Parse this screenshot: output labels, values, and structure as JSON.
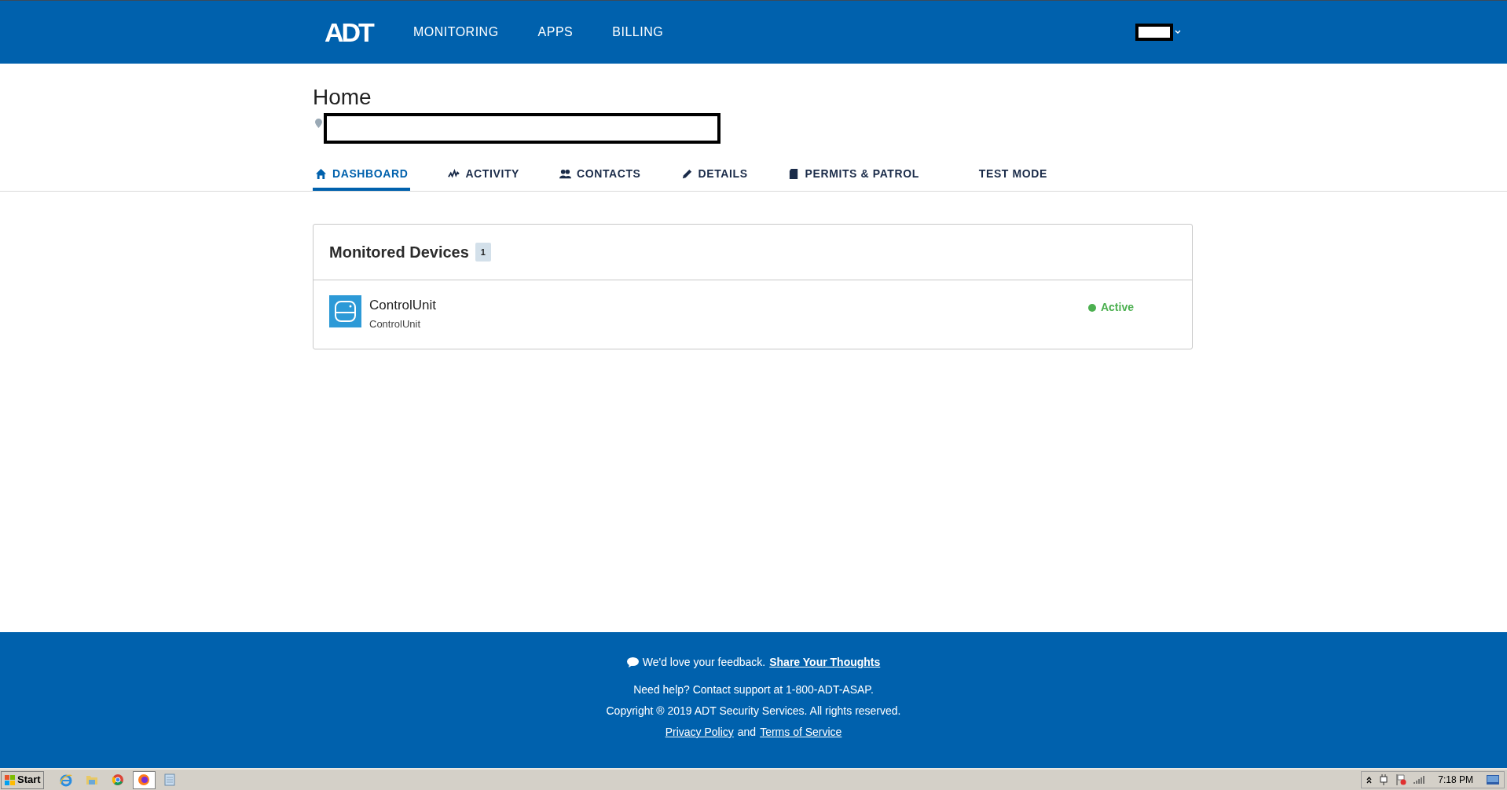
{
  "header": {
    "logo": "ADT",
    "nav": [
      "MONITORING",
      "APPS",
      "BILLING"
    ]
  },
  "page": {
    "title": "Home"
  },
  "tabs": [
    {
      "label": "DASHBOARD",
      "selected": true
    },
    {
      "label": "ACTIVITY",
      "selected": false
    },
    {
      "label": "CONTACTS",
      "selected": false
    },
    {
      "label": "DETAILS",
      "selected": false
    },
    {
      "label": "PERMITS & PATROL",
      "selected": false
    },
    {
      "label": "TEST MODE",
      "selected": false
    }
  ],
  "monitored_devices": {
    "title": "Monitored Devices",
    "count": "1",
    "devices": [
      {
        "name": "ControlUnit",
        "type": "ControlUnit",
        "status": "Active",
        "color": "#4cb050"
      }
    ]
  },
  "footer": {
    "feedback": "We'd love your feedback.",
    "feedback_link": "Share Your Thoughts",
    "help": "Need help? Contact support at 1-800-ADT-ASAP.",
    "copyright": "Copyright ® 2019 ADT Security Services. All rights reserved.",
    "privacy": "Privacy Policy",
    "joiner": "and",
    "terms": "Terms of Service"
  },
  "taskbar": {
    "start": "Start",
    "apps": [
      {
        "selected": false
      },
      {
        "selected": false
      },
      {
        "selected": false
      },
      {
        "selected": true
      },
      {
        "selected": false
      }
    ],
    "clock": "7:18 PM"
  }
}
